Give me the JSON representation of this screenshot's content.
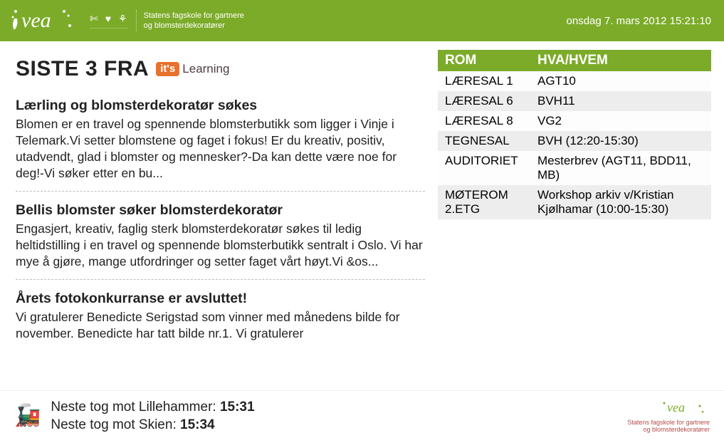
{
  "header": {
    "org_name": "vea",
    "tagline_line1": "Statens fagskole for gartnere",
    "tagline_line2": "og blomsterdekoratører",
    "datetime": "onsdag 7. mars 2012 15:21:10"
  },
  "section_title": "SISTE 3 FRA",
  "its_badge": {
    "pill": "it's",
    "word": "Learning"
  },
  "news": [
    {
      "title": "Lærling og blomsterdekoratør søkes",
      "body": "Blomen er en travel og spennende blomsterbutikk som ligger i Vinje i Telemark.Vi setter blomstene og faget i fokus! Er du kreativ, positiv, utadvendt, glad i blomster og mennesker?-Da kan dette være noe for deg!-Vi søker etter en bu..."
    },
    {
      "title": "Bellis blomster søker blomsterdekoratør",
      "body": "Engasjert, kreativ, faglig sterk blomsterdekoratør søkes til ledig heltidstilling i en travel og spennende blomsterbutikk sentralt i Oslo. Vi har mye å gjøre, mange utfordringer og setter faget vårt høyt.Vi &os..."
    },
    {
      "title": "Årets fotokonkurranse er avsluttet!",
      "body": "Vi gratulerer Benedicte Serigstad som vinner med månedens bilde for november. Benedicte har tatt bilde nr.1. Vi gratulerer"
    }
  ],
  "room_table": {
    "headers": [
      "ROM",
      "HVA/HVEM"
    ],
    "rows": [
      {
        "room": "LÆRESAL 1",
        "what": "AGT10"
      },
      {
        "room": "LÆRESAL 6",
        "what": "BVH11"
      },
      {
        "room": "LÆRESAL 8",
        "what": "VG2"
      },
      {
        "room": "TEGNESAL",
        "what": "BVH (12:20-15:30)"
      },
      {
        "room": "AUDITORIET",
        "what": "Mesterbrev (AGT11, BDD11, MB)"
      },
      {
        "room": "MØTEROM 2.ETG",
        "what": "Workshop arkiv v/Kristian Kjølhamar (10:00-15:30)"
      }
    ]
  },
  "trains": {
    "line1_label": "Neste tog mot Lillehammer: ",
    "line1_time": "15:31",
    "line2_label": "Neste tog mot Skien: ",
    "line2_time": "15:34"
  },
  "footer_logo": {
    "name": "vea",
    "line1": "Statens fagskole for gartnere",
    "line2": "og blomsterdekoratører"
  }
}
